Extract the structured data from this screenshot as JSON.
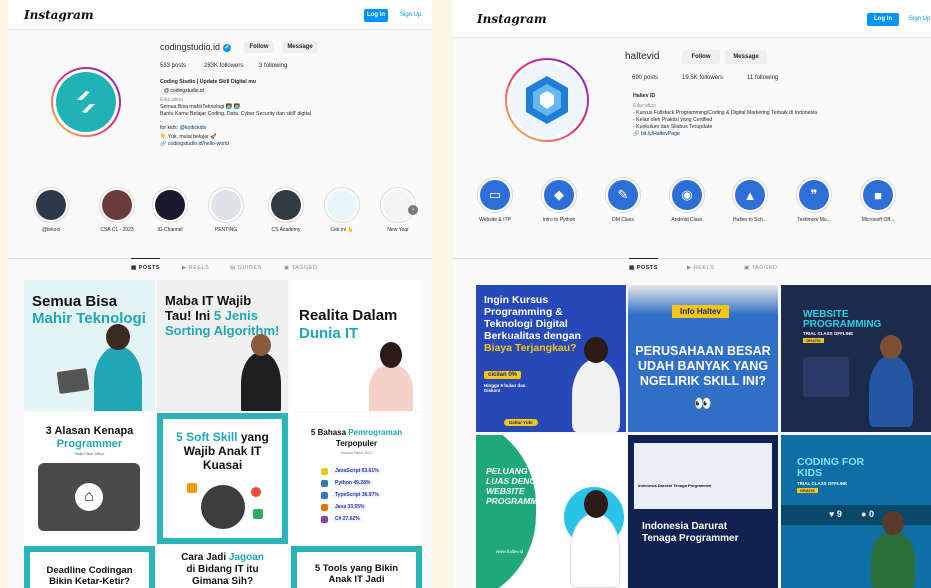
{
  "left": {
    "brand": "Instagram",
    "login_label": "Log In",
    "signup_label": "Sign Up",
    "username": "codingstudio.id",
    "verified_icon": "✔",
    "follow_label": "Follow",
    "message_label": "Message",
    "stats": {
      "posts": "533 posts",
      "followers": "283K followers",
      "following": "3 following"
    },
    "bio": {
      "name": "Coding Studio | Update Skill Digital mu",
      "chip": "codingstudio.id",
      "category": "Education",
      "line1": "Semua Bisa mahirTeknologi 👩‍💻 👨‍💻",
      "line2": "Bantu Kamu Belajar Coding, Data, Cyber Security dan skill' digital",
      "line3": "..",
      "kids_prefix": "for kids: ",
      "kids_handle": "@kodickids",
      "cta": "👇 Yuk, mulai belajar 🚀",
      "link": "codingstudio.id/hello-world"
    },
    "highlights": [
      {
        "label": "@tekoci",
        "color": "#2b3a4a"
      },
      {
        "label": "CSA C1 - 2023",
        "color": "#6a3b3b"
      },
      {
        "label": "IG Channel",
        "color": "#1a1a2e"
      },
      {
        "label": "PENTING",
        "color": "#dfe3e8"
      },
      {
        "label": "CS Academy",
        "color": "#333b44"
      },
      {
        "label": "Cek ini 👆",
        "color": "#e8f6fb"
      },
      {
        "label": "New Year",
        "color": "#f4f4f4"
      }
    ],
    "tabs": {
      "posts": "POSTS",
      "reels": "REELS",
      "guides": "GUIDES",
      "tagged": "TAGGED"
    },
    "posts": {
      "p1": {
        "line1": "Semua Bisa",
        "line2": "Mahir Teknologi"
      },
      "p2": {
        "line1": "Maba IT Wajib",
        "line2": "Tau! Ini ",
        "hl": "5 Jenis",
        "line3": "Sorting Algorithm!"
      },
      "p3": {
        "line1": "Realita Dalam",
        "line2": "Dunia IT"
      },
      "p4": {
        "line1": "3 Alasan Kenapa",
        "hl": "Programmer",
        "line2": "Wajib Pakai Github"
      },
      "p5": {
        "hl": "5 Soft Skill",
        "line1": " yang",
        "line2": "Wajib Anak IT",
        "line3": "Kuasai"
      },
      "p6": {
        "line1": "5 Bahasa ",
        "hl": "Pemrograman",
        "line2": "Terpopuler",
        "sub": "Selama Tahun 2022",
        "langs": [
          {
            "name": "JavaScript 63.61%",
            "color": "#f0c419"
          },
          {
            "name": "Python 49.28%",
            "color": "#3776ab"
          },
          {
            "name": "TypeScript 36.97%",
            "color": "#3178c6"
          },
          {
            "name": "Java 33.55%",
            "color": "#e76f00"
          },
          {
            "name": "C# 27.62%",
            "color": "#8e44ad"
          }
        ]
      },
      "p7": {
        "line1": "Deadline Codingan",
        "line2": "Bikin Ketar-Ketir?"
      },
      "p8": {
        "line1": "Cara Jadi ",
        "hl": "Jagoan",
        "line2": "di Bidang IT itu",
        "line3": "Gimana Sih?"
      },
      "p9": {
        "line1": "5 Tools yang Bikin",
        "line2": "Anak IT Jadi"
      }
    }
  },
  "right": {
    "brand": "Instagram",
    "login_label": "Log In",
    "signup_label": "Sign Up",
    "username": "haltevid",
    "follow_label": "Follow",
    "message_label": "Message",
    "stats": {
      "posts": "690 posts",
      "followers": "19.5K followers",
      "following": "11 following"
    },
    "bio": {
      "name": "Haltev ID",
      "category": "Education",
      "line1": "- Kursus Fullstack Programming/Coding & Digital Marketing Terbaik di Indonesia",
      "line2": "- Kelas oleh Praktisi yang Certified",
      "line3": "- Kurikulum dan Silabus Terupdate",
      "link": "bit.ly/HaltevPage"
    },
    "highlights": [
      {
        "label": "Website & ITP",
        "color": "#2d6fd6",
        "glyph": "▭"
      },
      {
        "label": "Intro to Python",
        "color": "#2d6fd6",
        "glyph": "◆"
      },
      {
        "label": "DM Class",
        "color": "#2d6fd6",
        "glyph": "✎"
      },
      {
        "label": "Android Class",
        "color": "#2d6fd6",
        "glyph": "◉"
      },
      {
        "label": "Haltev to Sch...",
        "color": "#2d6fd6",
        "glyph": "▲"
      },
      {
        "label": "Testimoni Mu...",
        "color": "#2d6fd6",
        "glyph": "❞"
      },
      {
        "label": "Microsoft Off...",
        "color": "#2d6fd6",
        "glyph": "■"
      }
    ],
    "tabs": {
      "posts": "POSTS",
      "reels": "REELS",
      "tagged": "TAGGED"
    },
    "posts": {
      "p1": {
        "line1": "Ingin Kursus",
        "line2": "Programming &",
        "line3": "Teknologi Digital",
        "line4": "Berkualitas dengan",
        "hl": "Biaya Terjangkau?",
        "price": "cicilan 0%",
        "note": "Hingga 9 bulan dan Diskon!",
        "cta": "Daftar Yuk!"
      },
      "p2": {
        "tag": "Info Haltev",
        "line1": "PERUSAHAAN BESAR",
        "line2": "UDAH BANYAK YANG",
        "line3": "NGELIRIK SKILL INI?",
        "eyes": "👀"
      },
      "p3": {
        "line1": "WEBSITE",
        "line2": "PROGRAMMING",
        "sub": "TRIAL CLASS OFFLINE",
        "badge": "GRATIS"
      },
      "p4": {
        "line1": "PELUANG KARIR",
        "line2": "LUAS DENGAN",
        "line3": "WEBSITE",
        "line4": "PROGRAMMING",
        "url": "www.haltev.id"
      },
      "p5": {
        "head": "Indonesia Darurat Tenaga Programmer",
        "line1": "Indonesia Darurat",
        "line2": "Tenaga Programmer"
      },
      "p6": {
        "line1": "CODING FOR",
        "line2": "KIDS",
        "sub": "TRIAL CLASS OFFLINE",
        "badge": "GRATIS",
        "likes": "9",
        "comments": "0"
      }
    }
  }
}
